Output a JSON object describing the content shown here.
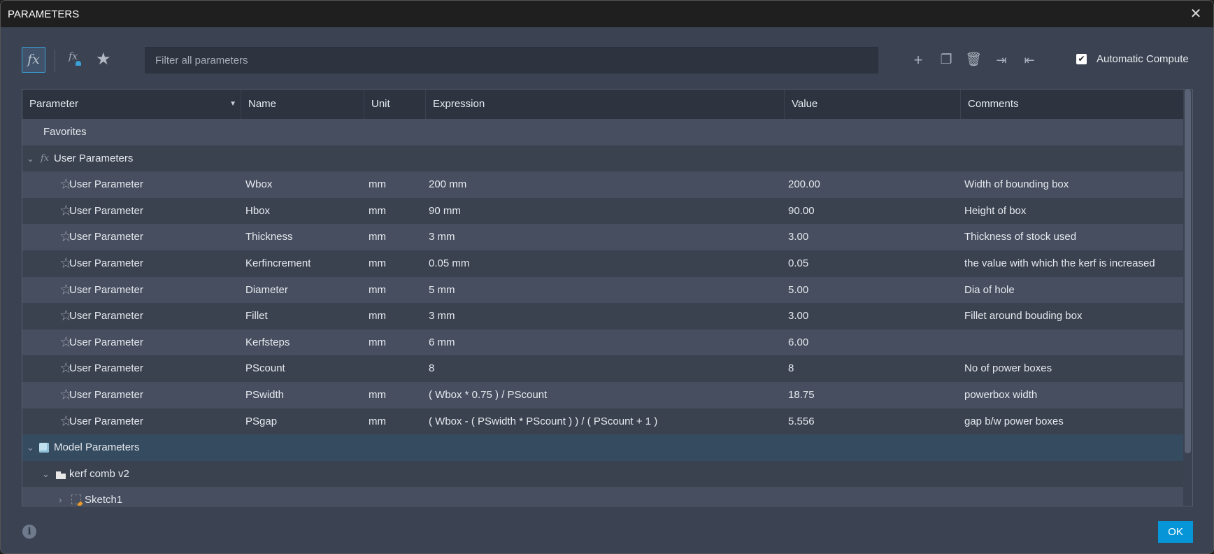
{
  "window": {
    "title": "PARAMETERS",
    "close_icon": "close-icon"
  },
  "toolbar": {
    "filter_placeholder": "Filter all parameters",
    "automatic_compute_label": "Automatic Compute",
    "automatic_compute_checked": true,
    "fx_label": "fx",
    "fx_user_label": "fx"
  },
  "table": {
    "columns": [
      "Parameter",
      "Name",
      "Unit",
      "Expression",
      "Value",
      "Comments"
    ],
    "favorites_label": "Favorites",
    "user_group_label": "User Parameters",
    "rows": [
      {
        "parameter": "User Parameter",
        "name": "Wbox",
        "unit": "mm",
        "expression": "200 mm",
        "value": "200.00",
        "comments": "Width of bounding box"
      },
      {
        "parameter": "User Parameter",
        "name": "Hbox",
        "unit": "mm",
        "expression": "90 mm",
        "value": "90.00",
        "comments": "Height of box"
      },
      {
        "parameter": "User Parameter",
        "name": "Thickness",
        "unit": "mm",
        "expression": "3 mm",
        "value": "3.00",
        "comments": "Thickness of stock used"
      },
      {
        "parameter": "User Parameter",
        "name": "Kerfincrement",
        "unit": "mm",
        "expression": "0.05 mm",
        "value": "0.05",
        "comments": "the value with which the kerf is increased"
      },
      {
        "parameter": "User Parameter",
        "name": "Diameter",
        "unit": "mm",
        "expression": "5 mm",
        "value": "5.00",
        "comments": "Dia of hole"
      },
      {
        "parameter": "User Parameter",
        "name": "Fillet",
        "unit": "mm",
        "expression": "3 mm",
        "value": "3.00",
        "comments": "Fillet around bouding box"
      },
      {
        "parameter": "User Parameter",
        "name": "Kerfsteps",
        "unit": "mm",
        "expression": "6 mm",
        "value": "6.00",
        "comments": ""
      },
      {
        "parameter": "User Parameter",
        "name": "PScount",
        "unit": "",
        "expression": "8",
        "value": "8",
        "comments": "No of power boxes"
      },
      {
        "parameter": "User Parameter",
        "name": "PSwidth",
        "unit": "mm",
        "expression": "( Wbox * 0.75 ) / PScount",
        "value": "18.75",
        "comments": "powerbox width"
      },
      {
        "parameter": "User Parameter",
        "name": "PSgap",
        "unit": "mm",
        "expression": "( Wbox - ( PSwidth * PScount ) ) / ( PScount + 1 )",
        "value": "5.556",
        "comments": "gap b/w power boxes"
      }
    ],
    "model_group_label": "Model Parameters",
    "component_label": "kerf comb v2",
    "sketch_label": "Sketch1"
  },
  "footer": {
    "ok_label": "OK"
  },
  "colors": {
    "accent": "#0696d7",
    "background": "#3b4352",
    "header": "#2d3440"
  }
}
